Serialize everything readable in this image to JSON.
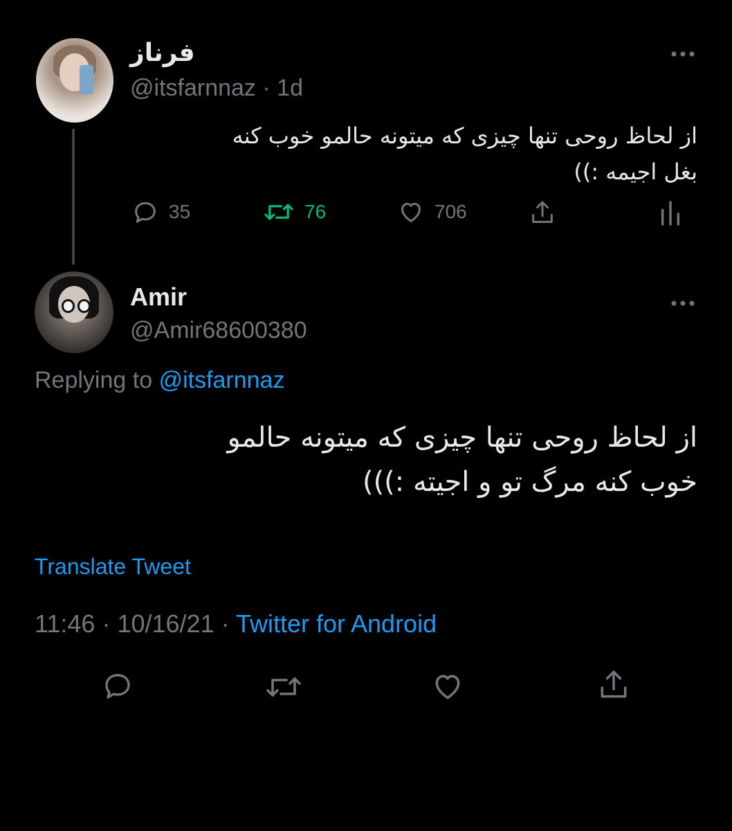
{
  "parent_tweet": {
    "display_name": "فرناز",
    "handle": "@itsfarnnaz",
    "time": "1d",
    "text_line1": "از لحاظ روحی تنها چیزی که میتونه حالمو خوب کنه",
    "text_line2": "بغل اجیمه :))",
    "replies_count": "35",
    "retweets_count": "76",
    "likes_count": "706",
    "icons": {
      "reply": "reply-icon",
      "retweet": "retweet-icon",
      "like": "heart-icon",
      "share": "share-icon",
      "analytics": "analytics-icon",
      "more": "more-icon"
    }
  },
  "reply_tweet": {
    "display_name": "Amir",
    "handle": "@Amir68600380",
    "replying_to_label": "Replying to",
    "replying_to_handle": "@itsfarnnaz",
    "text_line1": "از لحاظ روحی تنها چیزی که میتونه حالمو",
    "text_line2": "خوب کنه مرگ تو و اجیته :)))",
    "translate_label": "Translate Tweet",
    "time": "11:46",
    "date": "10/16/21",
    "source": "Twitter for Android",
    "separator": "·"
  },
  "colors": {
    "background": "#000000",
    "primary_text": "#e7e9ea",
    "secondary_text": "#71767b",
    "accent": "#1d9bf0",
    "retweet_active": "#00ba7c",
    "thread_line": "#3e4144"
  }
}
